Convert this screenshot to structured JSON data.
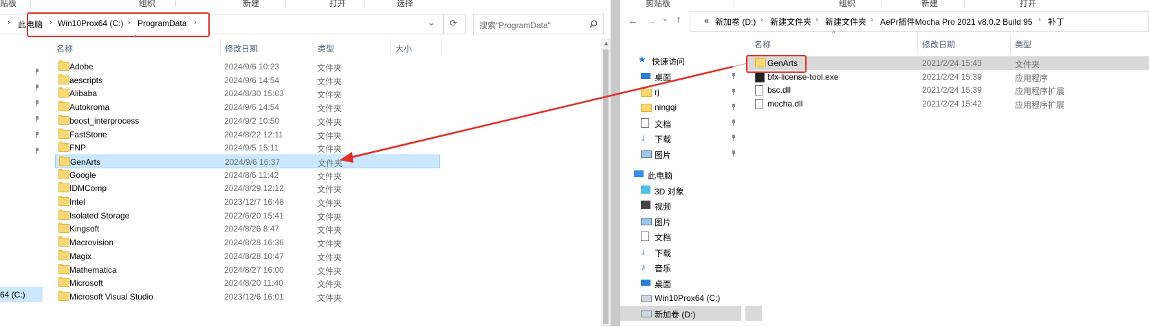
{
  "left": {
    "ribbon": [
      "贴板",
      "组织",
      "新建",
      "打开",
      "选择"
    ],
    "breadcrumb": [
      "此电脑",
      "Win10Prox64 (C:)",
      "ProgramData"
    ],
    "search_placeholder": "搜索\"ProgramData\"",
    "columns": {
      "name": "名称",
      "date": "修改日期",
      "type": "类型",
      "size": "大小"
    },
    "files": [
      {
        "name": "Adobe",
        "date": "2024/9/6 10:23",
        "type": "文件夹"
      },
      {
        "name": "aescripts",
        "date": "2024/9/6 14:54",
        "type": "文件夹"
      },
      {
        "name": "Alibaba",
        "date": "2024/8/30 15:03",
        "type": "文件夹"
      },
      {
        "name": "Autokroma",
        "date": "2024/9/6 14:54",
        "type": "文件夹"
      },
      {
        "name": "boost_interprocess",
        "date": "2024/9/2 10:50",
        "type": "文件夹"
      },
      {
        "name": "FastStone",
        "date": "2024/8/22 12:11",
        "type": "文件夹"
      },
      {
        "name": "FNP",
        "date": "2024/9/5 15:11",
        "type": "文件夹"
      },
      {
        "name": "GenArts",
        "date": "2024/9/6 16:37",
        "type": "文件夹"
      },
      {
        "name": "Google",
        "date": "2024/8/6 11:42",
        "type": "文件夹"
      },
      {
        "name": "IDMComp",
        "date": "2024/8/29 12:12",
        "type": "文件夹"
      },
      {
        "name": "Intel",
        "date": "2023/12/7 16:48",
        "type": "文件夹"
      },
      {
        "name": "Isolated Storage",
        "date": "2022/6/20 15:41",
        "type": "文件夹"
      },
      {
        "name": "Kingsoft",
        "date": "2024/8/26 8:47",
        "type": "文件夹"
      },
      {
        "name": "Macrovision",
        "date": "2024/8/28 16:36",
        "type": "文件夹"
      },
      {
        "name": "Magix",
        "date": "2024/8/28 10:47",
        "type": "文件夹"
      },
      {
        "name": "Mathematica",
        "date": "2024/8/27 16:00",
        "type": "文件夹"
      },
      {
        "name": "Microsoft",
        "date": "2024/8/20 11:40",
        "type": "文件夹"
      },
      {
        "name": "Microsoft Visual Studio",
        "date": "2023/12/6 16:01",
        "type": "文件夹"
      }
    ],
    "nav_drive": "64 (C:)"
  },
  "right": {
    "ribbon": [
      "剪贴板",
      "组织",
      "新建",
      "打开"
    ],
    "breadcrumb_prefix": "«",
    "breadcrumb": [
      "新加卷 (D:)",
      "新建文件夹",
      "新建文件夹",
      "AePr插件Mocha Pro 2021 v8.0.2 Build 95",
      "补丁"
    ],
    "columns": {
      "name": "名称",
      "date": "修改日期",
      "type": "类型"
    },
    "nav": [
      {
        "label": "快速访问",
        "icon": "star-icon"
      },
      {
        "label": "桌面",
        "icon": "desktop-icon"
      },
      {
        "label": "rj",
        "icon": "folder-icon"
      },
      {
        "label": "ningqi",
        "icon": "folder-icon"
      },
      {
        "label": "文档",
        "icon": "document-icon"
      },
      {
        "label": "下载",
        "icon": "download-icon"
      },
      {
        "label": "图片",
        "icon": "picture-icon"
      },
      {
        "label": "此电脑",
        "icon": "computer-icon"
      },
      {
        "label": "3D 对象",
        "icon": "cube-icon"
      },
      {
        "label": "视频",
        "icon": "video-icon"
      },
      {
        "label": "图片",
        "icon": "picture-icon"
      },
      {
        "label": "文档",
        "icon": "document-icon"
      },
      {
        "label": "下载",
        "icon": "download-icon"
      },
      {
        "label": "音乐",
        "icon": "music-icon"
      },
      {
        "label": "桌面",
        "icon": "desktop-icon"
      },
      {
        "label": "Win10Prox64 (C:)",
        "icon": "drive-icon"
      },
      {
        "label": "新加卷 (D:)",
        "icon": "drive-icon"
      }
    ],
    "files": [
      {
        "name": "GenArts",
        "date": "2021/2/24 15:43",
        "type": "文件夹",
        "icon": "folder-icon"
      },
      {
        "name": "bfx-license-tool.exe",
        "date": "2021/2/24 15:39",
        "type": "应用程序",
        "icon": "exe-icon"
      },
      {
        "name": "bsc.dll",
        "date": "2021/2/24 15:39",
        "type": "应用程序扩展",
        "icon": "dll-icon"
      },
      {
        "name": "mocha.dll",
        "date": "2021/2/24 15:42",
        "type": "应用程序扩展",
        "icon": "dll-icon"
      }
    ]
  },
  "colors": {
    "highlight": "#e0312b",
    "selection": "#cce8ff",
    "header_text": "#4c607a"
  }
}
